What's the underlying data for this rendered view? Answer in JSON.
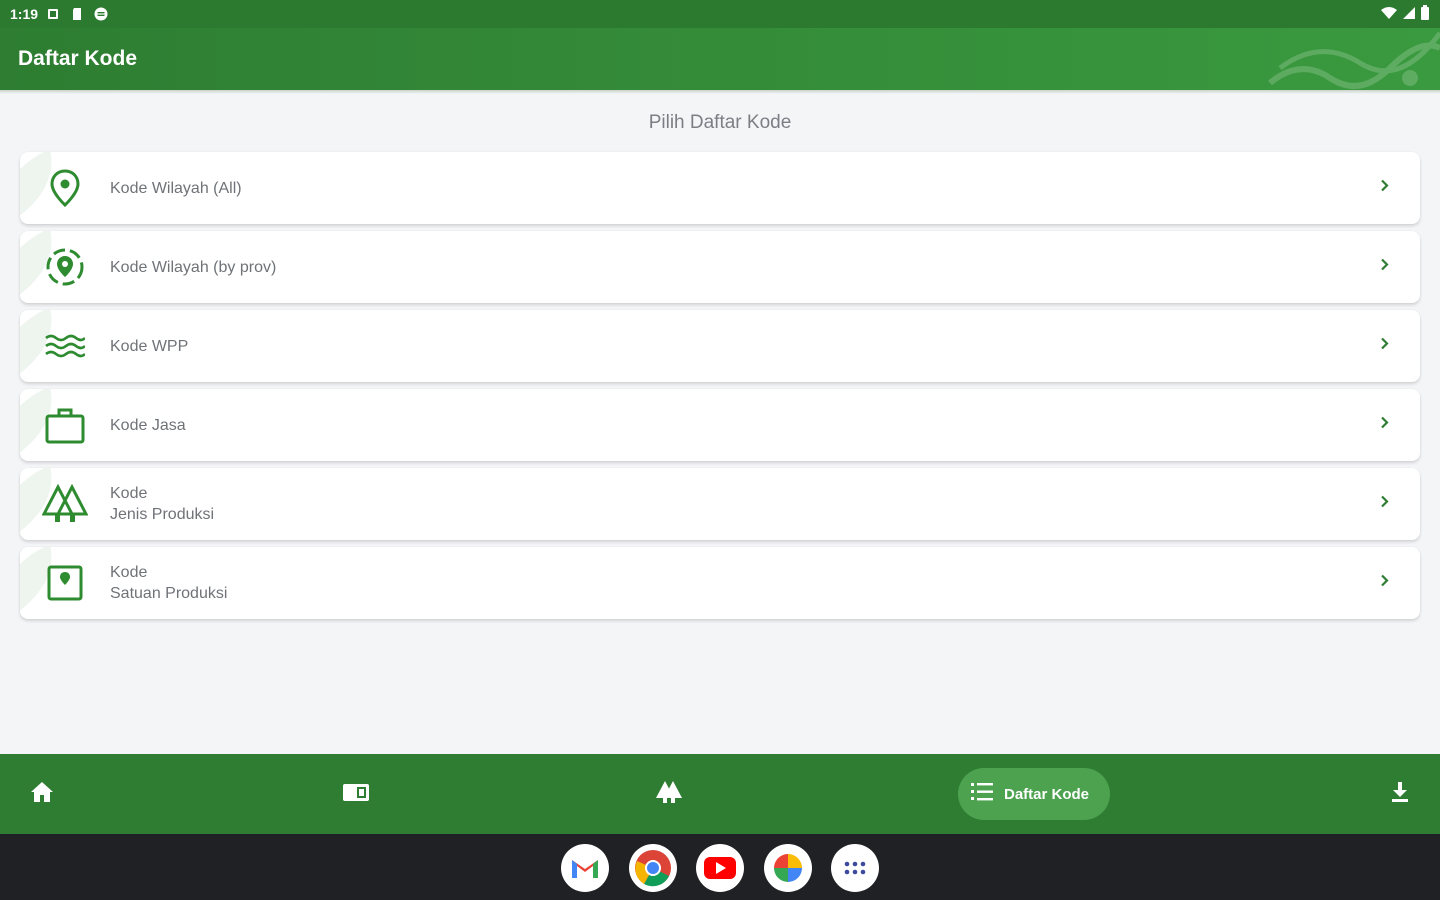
{
  "status_bar": {
    "time": "1:19",
    "icons_left": [
      "notification-icon",
      "sd-card-icon",
      "vpn-icon"
    ],
    "icons_right": [
      "wifi-icon",
      "signal-icon",
      "battery-icon"
    ]
  },
  "app_bar": {
    "title": "Daftar Kode"
  },
  "main": {
    "section_title": "Pilih Daftar Kode",
    "items": [
      {
        "lines": [
          "Kode Wilayah (All)"
        ],
        "icon": "location-pin-icon"
      },
      {
        "lines": [
          "Kode Wilayah (by prov)"
        ],
        "icon": "location-search-icon"
      },
      {
        "lines": [
          "Kode WPP"
        ],
        "icon": "waves-icon"
      },
      {
        "lines": [
          "Kode Jasa"
        ],
        "icon": "briefcase-icon"
      },
      {
        "lines": [
          "Kode",
          "Jenis Produksi"
        ],
        "icon": "forest-icon"
      },
      {
        "lines": [
          "Kode",
          "Satuan Produksi"
        ],
        "icon": "unit-box-icon"
      }
    ]
  },
  "bottom_nav": {
    "items": [
      {
        "name": "home",
        "icon": "home-icon"
      },
      {
        "name": "map",
        "icon": "map-icon"
      },
      {
        "name": "forest",
        "icon": "forest-icon"
      },
      {
        "name": "daftar-kode",
        "icon": "list-icon",
        "label": "Daftar Kode",
        "active": true
      },
      {
        "name": "download",
        "icon": "download-icon"
      }
    ]
  },
  "taskbar": {
    "apps": [
      "gmail-icon",
      "chrome-icon",
      "youtube-icon",
      "photos-icon",
      "app-drawer-icon"
    ]
  },
  "colors": {
    "primary": "#2e7d32",
    "primary_light": "#4ca24f",
    "status_bar": "#2c7a30",
    "background": "#f4f5f7",
    "text_muted": "#6f7378",
    "taskbar": "#1f2124"
  }
}
